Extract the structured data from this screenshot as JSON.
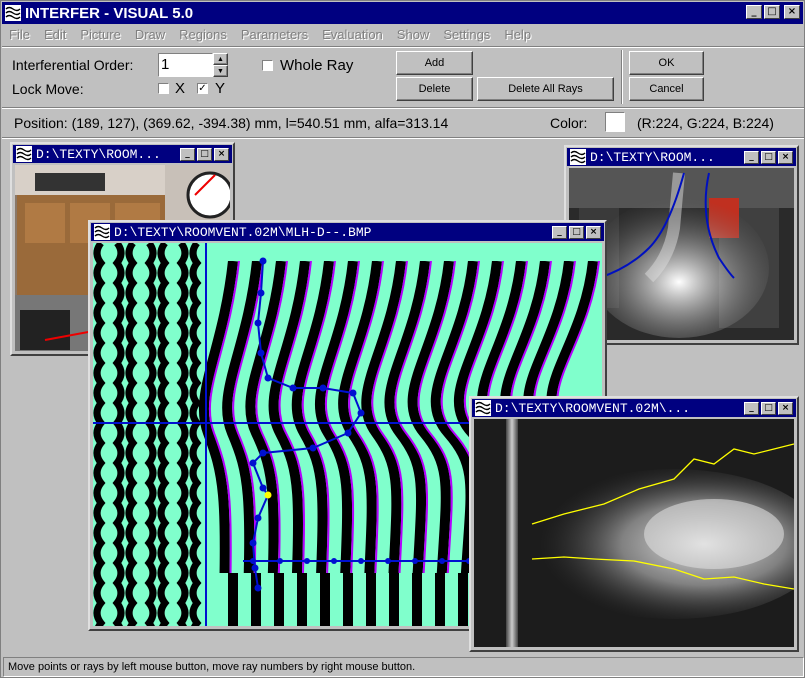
{
  "app": {
    "title": "INTERFER - VISUAL  5.0"
  },
  "menu": [
    "File",
    "Edit",
    "Picture",
    "Draw",
    "Regions",
    "Parameters",
    "Evaluation",
    "Show",
    "Settings",
    "Help"
  ],
  "controls": {
    "order_label": "Interferential Order:",
    "order_value": "1",
    "whole_ray_label": "Whole Ray",
    "lock_move_label": "Lock Move:",
    "x_label": "X",
    "y_label": "Y",
    "x_checked": false,
    "y_checked": true,
    "whole_ray_checked": false,
    "add_label": "Add",
    "delete_label": "Delete",
    "delete_all_label": "Delete All Rays",
    "ok_label": "OK",
    "cancel_label": "Cancel"
  },
  "info": {
    "position": "Position: (189, 127), (369.62, -394.38) mm, l=540.51 mm, alfa=313.14",
    "color_label": "Color:",
    "color_value": "(R:224, G:224, B:224)",
    "color_swatch": "#ffffff"
  },
  "windows": {
    "left_title": "D:\\TEXTY\\ROOM...",
    "right_title": "D:\\TEXTY\\ROOM...",
    "main_title": "D:\\TEXTY\\ROOMVENT.02M\\MLH-D--.BMP",
    "smoke_title": "D:\\TEXTY\\ROOMVENT.02M\\..."
  },
  "status": "Move points or rays by left mouse button, move ray numbers by right mouse button.",
  "colors": {
    "title_bar": "#000080",
    "fringe_bg": "#80ffcc",
    "ray": "#0000ff",
    "fringe_line": "#b400ff",
    "smoke_line": "#ffff00"
  },
  "icons": {
    "app": "interfer-wave-icon",
    "minimize": "minimize-icon",
    "maximize": "maximize-icon",
    "close": "close-icon"
  }
}
